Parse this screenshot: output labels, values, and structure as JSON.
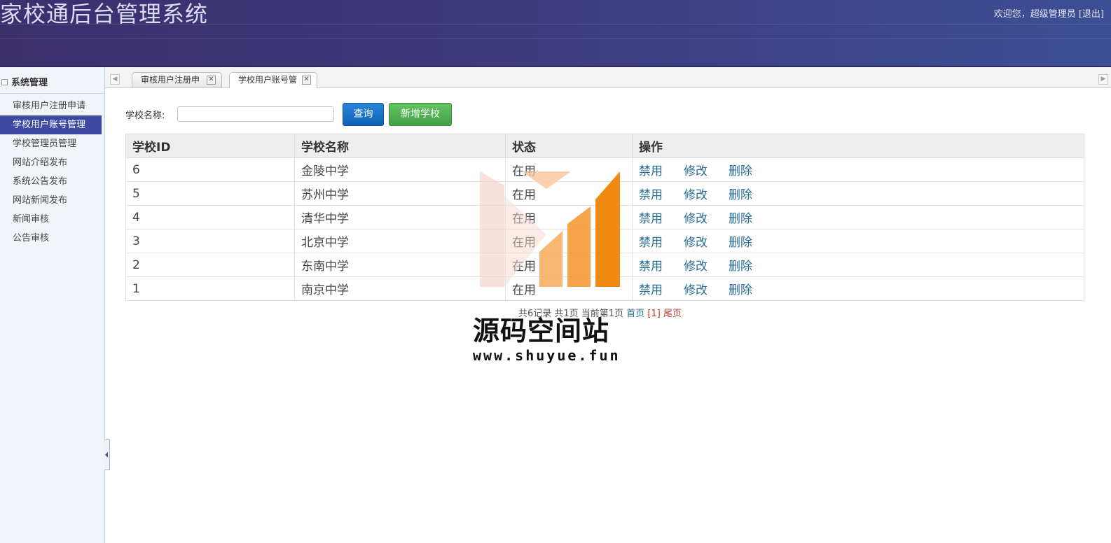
{
  "header": {
    "app_title": "家校通后台管理系统",
    "welcome": "欢迎您，超级管理员",
    "logout": "[退出]"
  },
  "sidebar": {
    "group_title": "系统管理",
    "items": [
      {
        "label": "审核用户注册申请",
        "active": false
      },
      {
        "label": "学校用户账号管理",
        "active": true
      },
      {
        "label": "学校管理员管理",
        "active": false
      },
      {
        "label": "网站介绍发布",
        "active": false
      },
      {
        "label": "系统公告发布",
        "active": false
      },
      {
        "label": "网站新闻发布",
        "active": false
      },
      {
        "label": "新闻审核",
        "active": false
      },
      {
        "label": "公告审核",
        "active": false
      }
    ]
  },
  "tabs": [
    {
      "label": "审核用户注册申",
      "active": false
    },
    {
      "label": "学校用户账号管",
      "active": true
    }
  ],
  "search": {
    "label": "学校名称:",
    "value": "",
    "placeholder": "",
    "query_button": "查询",
    "add_button": "新增学校"
  },
  "table": {
    "headers": [
      "学校ID",
      "学校名称",
      "状态",
      "操作"
    ],
    "rows": [
      {
        "id": "6",
        "name": "金陵中学",
        "status": "在用"
      },
      {
        "id": "5",
        "name": "苏州中学",
        "status": "在用"
      },
      {
        "id": "4",
        "name": "清华中学",
        "status": "在用"
      },
      {
        "id": "3",
        "name": "北京中学",
        "status": "在用"
      },
      {
        "id": "2",
        "name": "东南中学",
        "status": "在用"
      },
      {
        "id": "1",
        "name": "南京中学",
        "status": "在用"
      }
    ],
    "actions": {
      "disable": "禁用",
      "edit": "修改",
      "delete": "删除"
    }
  },
  "pager": {
    "summary": "共6记录 共1页 当前第1页",
    "first": "首页",
    "current": "[1]",
    "last": "尾页"
  },
  "watermark": {
    "title": "源码空间站",
    "url": "www.shuyue.fun"
  },
  "colors": {
    "header_bg": "#3e3a7c",
    "active_menu": "#3b4aa0",
    "query_button": "#1670c8",
    "add_button": "#4cae4c",
    "action_link": "#2a6e96",
    "pager_current": "#c0392b",
    "logo_orange": "#f39220"
  }
}
